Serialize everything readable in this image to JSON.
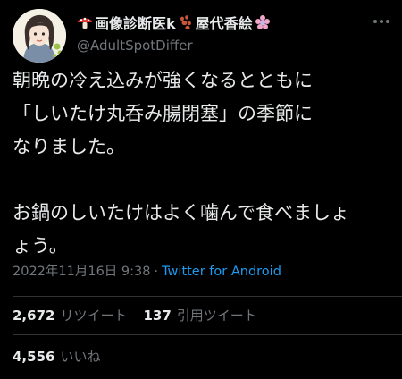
{
  "user": {
    "display_name_text_1": "画像診断医k",
    "display_name_text_2": "屋代香絵",
    "handle": "@AdultSpotDiffer",
    "icons": [
      "mushroom-icon",
      "paw-prints-icon",
      "flower-icon"
    ]
  },
  "tweet": {
    "lines": [
      "朝晩の冷え込みが強くなるとともに",
      "「しいたけ丸呑み腸閉塞」の季節に",
      "なりました。",
      "",
      "お鍋のしいたけはよく噛んで食べましょ",
      "ょう。"
    ]
  },
  "meta": {
    "timestamp": "2022年11月16日 9:38",
    "separator": "·",
    "source": "Twitter for Android"
  },
  "stats": {
    "retweets_count": "2,672",
    "retweets_label": "リツイート",
    "quotes_count": "137",
    "quotes_label": "引用ツイート",
    "likes_count": "4,556",
    "likes_label": "いいね"
  },
  "colors": {
    "background": "#000000",
    "text": "#e7e9ea",
    "secondary": "#71767b",
    "link": "#1d9bf0",
    "divider": "#2f3336"
  }
}
